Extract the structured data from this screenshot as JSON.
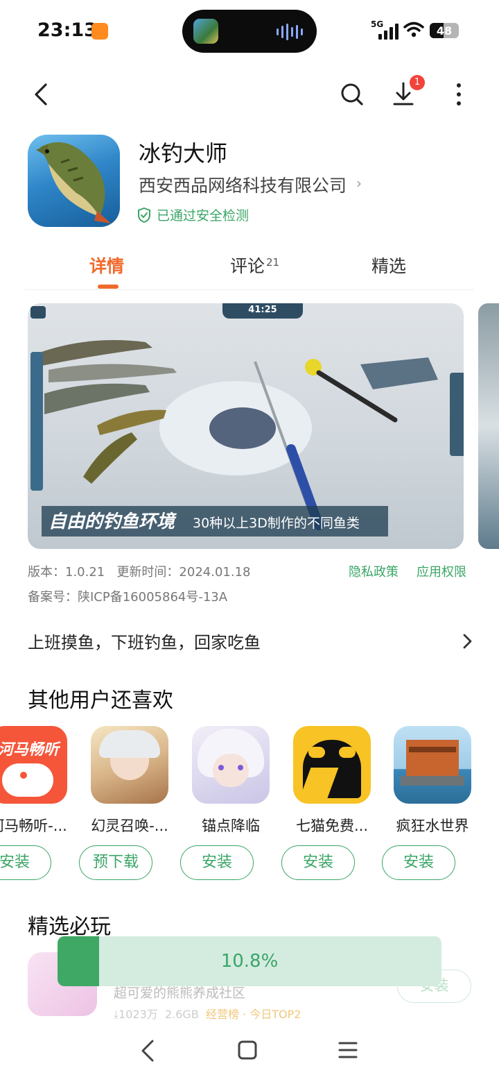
{
  "status_bar": {
    "time": "23:13",
    "network": "5G",
    "battery": "48",
    "battery_level": 0.48
  },
  "app": {
    "name": "冰钓大师",
    "developer": "西安西品网络科技有限公司",
    "safety": "已通过安全检测",
    "download_badge": "1"
  },
  "tabs": [
    {
      "label": "详情"
    },
    {
      "label": "评论",
      "count": "21"
    },
    {
      "label": "精选"
    }
  ],
  "screenshot": {
    "hud_time": "41:25",
    "caption_main": "自由的钓鱼环境",
    "caption_sub": "30种以上3D制作的不同鱼类"
  },
  "meta": {
    "version": "版本：1.0.21",
    "updated": "更新时间：2024.01.18",
    "icp": "备案号：陕ICP备16005864号-13A",
    "privacy_link": "隐私政策",
    "permissions_link": "应用权限"
  },
  "slogan": "上班摸鱼，下班钓鱼，回家吃鱼",
  "others_like": {
    "title": "其他用户还喜欢",
    "apps": [
      {
        "name": "河马畅听-...",
        "button": "安装",
        "icon": "hippo-icon",
        "icon_text": "河马畅听"
      },
      {
        "name": "幻灵召唤-...",
        "button": "预下载",
        "icon": "anime-girl-icon"
      },
      {
        "name": "锚点降临",
        "button": "安装",
        "icon": "anime-white-hair-icon"
      },
      {
        "name": "七猫免费...",
        "button": "安装",
        "icon": "black-cat-icon"
      },
      {
        "name": "疯狂水世界",
        "button": "安装",
        "icon": "raft-house-icon"
      }
    ]
  },
  "featured": {
    "title": "精选必玩",
    "desc": "超可爱的熊熊养成社区",
    "downloads": "⤓1023万",
    "size": "2.6GB",
    "tag": "经营榜 · 今日TOP2",
    "button": "安装"
  },
  "download_progress": {
    "text": "10.8%",
    "fraction": 0.108
  },
  "colors": {
    "accent": "#f06a2d",
    "green": "#3aa566"
  }
}
